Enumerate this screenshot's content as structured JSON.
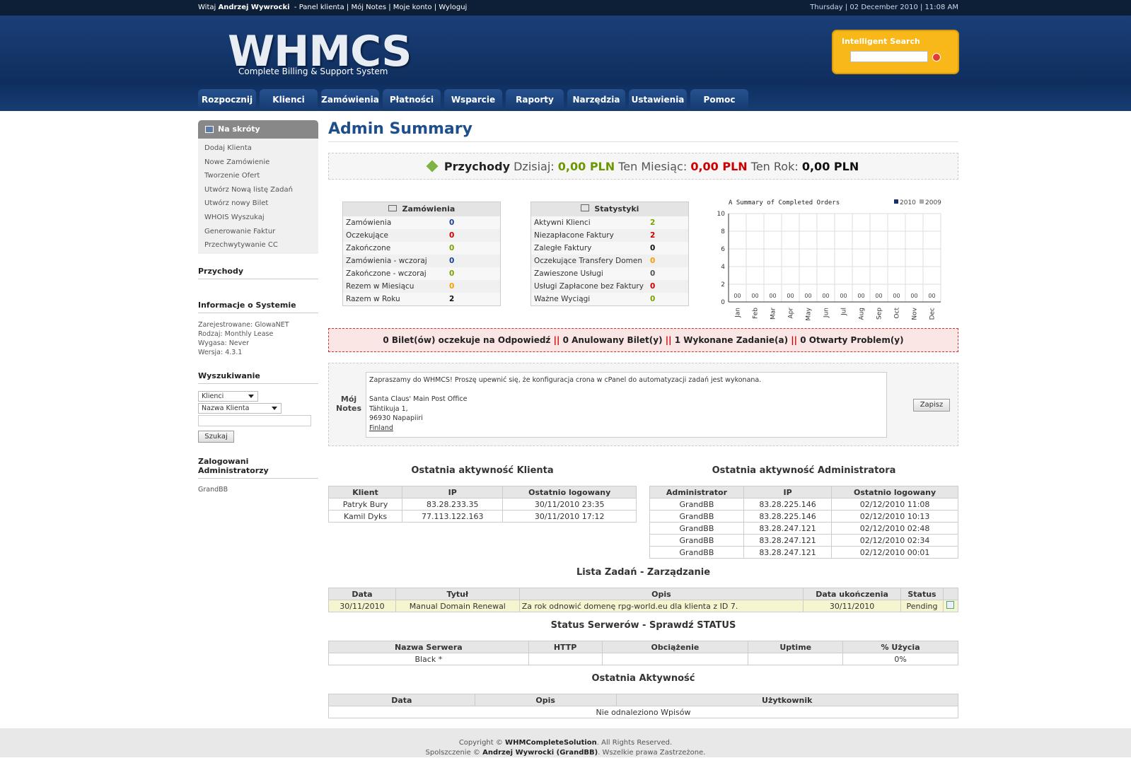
{
  "topbar": {
    "welcome": "Witaj",
    "user": "Andrzej Wywrocki",
    "links": [
      "Panel klienta",
      "Mój Notes",
      "Moje konto",
      "Wyloguj"
    ],
    "datetime": "Thursday | 02 December 2010 | 11:08 AM"
  },
  "header": {
    "logo": "WHMCS",
    "tagline": "Complete Billing & Support System",
    "search_title": "Intelligent Search"
  },
  "nav": [
    "Rozpocznij",
    "Klienci",
    "Zamówienia",
    "Płatności",
    "Wsparcie",
    "Raporty",
    "Narzędzia",
    "Ustawienia",
    "Pomoc"
  ],
  "sidebar": {
    "shortcuts_title": "Na skróty",
    "shortcuts": [
      "Dodaj Klienta",
      "Nowe Zamówienie",
      "Tworzenie Ofert",
      "Utwórz Nową listę Zadań",
      "Utwórz nowy Bilet",
      "WHOIS Wyszukaj",
      "Generowanie Faktur",
      "Przechwytywanie CC"
    ],
    "income_title": "Przychody",
    "sysinfo_title": "Informacje o Systemie",
    "sysinfo": [
      "Zarejestrowane: GlowaNET",
      "Rodzaj: Monthly Lease",
      "Wygasa: Never",
      "Wersja: 4.3.1"
    ],
    "search_title": "Wyszukiwanie",
    "search_select1": "Klienci",
    "search_select2": "Nazwa Klienta",
    "search_button": "Szukaj",
    "admins_title": "Zalogowani Administratorzy",
    "admins": "GrandBB"
  },
  "main": {
    "title": "Admin Summary",
    "income": {
      "label": "Przychody",
      "today_label": "Dzisiaj:",
      "today": "0,00 PLN",
      "month_label": "Ten Miesiąc:",
      "month": "0,00 PLN",
      "year_label": "Ten Rok:",
      "year": "0,00 PLN"
    },
    "orders": {
      "title": "Zamówienia",
      "rows": [
        {
          "label": "Zamówienia",
          "value": "0",
          "color": "#1a3f9a"
        },
        {
          "label": "Oczekujące",
          "value": "0",
          "color": "#cc0000"
        },
        {
          "label": "Zakończone",
          "value": "0",
          "color": "#77a300"
        },
        {
          "label": "Zamówienia - wczoraj",
          "value": "0",
          "color": "#1a3f9a"
        },
        {
          "label": "Zakończone - wczoraj",
          "value": "0",
          "color": "#77a300"
        },
        {
          "label": "Rezem w Miesiącu",
          "value": "0",
          "color": "#f2a000"
        },
        {
          "label": "Razem w Roku",
          "value": "2",
          "color": "#111111"
        }
      ]
    },
    "stats": {
      "title": "Statystyki",
      "rows": [
        {
          "label": "Aktywni Klienci",
          "value": "2",
          "color": "#77a300"
        },
        {
          "label": "Niezapłacone Faktury",
          "value": "2",
          "color": "#cc0000"
        },
        {
          "label": "Zaległe Faktury",
          "value": "0",
          "color": "#111111"
        },
        {
          "label": "Oczekujące Transfery Domen",
          "value": "0",
          "color": "#f2a000"
        },
        {
          "label": "Zawieszone Usługi",
          "value": "0",
          "color": "#555555"
        },
        {
          "label": "Usługi Zapłacone bez Faktury",
          "value": "0",
          "color": "#cc0000"
        },
        {
          "label": "Ważne Wyciągi",
          "value": "0",
          "color": "#77a300"
        }
      ]
    },
    "tickets": {
      "t1": "0 Bilet(ów) oczekuje na Odpowiedź",
      "t2": "0 Anulowany Bilet(y)",
      "t3": "1 Wykonane Zadanie(a)",
      "t4": "0 Otwarty Problem(y)",
      "sep": "||"
    },
    "notes": {
      "label1": "Mój",
      "label2": "Notes",
      "lines": [
        "Zapraszamy do WHMCS! Proszę upewnić się, że konfiguracja crona w cPanel do automatyzacji zadań jest wykonana.",
        "",
        "Santa Claus' Main Post Office",
        "Tähtikuja 1,",
        "96930 Napapiiri",
        "Finland"
      ],
      "save": "Zapisz"
    },
    "client_activity": {
      "title": "Ostatnia aktywność Klienta",
      "headers": [
        "Klient",
        "IP",
        "Ostatnio logowany"
      ],
      "rows": [
        [
          "Patryk Bury",
          "83.28.233.35",
          "30/11/2010 23:35"
        ],
        [
          "Kamil Dyks",
          "77.113.122.163",
          "30/11/2010 17:12"
        ]
      ]
    },
    "admin_activity": {
      "title": "Ostatnia aktywność Administratora",
      "headers": [
        "Administrator",
        "IP",
        "Ostatnio logowany"
      ],
      "rows": [
        [
          "GrandBB",
          "83.28.225.146",
          "02/12/2010 11:08"
        ],
        [
          "GrandBB",
          "83.28.225.146",
          "02/12/2010 10:13"
        ],
        [
          "GrandBB",
          "83.28.247.121",
          "02/12/2010 02:48"
        ],
        [
          "GrandBB",
          "83.28.247.121",
          "02/12/2010 02:34"
        ],
        [
          "GrandBB",
          "83.28.247.121",
          "02/12/2010 00:01"
        ]
      ]
    },
    "todo": {
      "title": "Lista Zadań - ",
      "title_link": "Zarządzanie",
      "headers": [
        "Data",
        "Tytuł",
        "Opis",
        "Data ukończenia",
        "Status"
      ],
      "rows": [
        [
          "30/11/2010",
          "Manual Domain Renewal",
          "Za rok odnowić domenę rpg-world.eu dla klienta z ID 7.",
          "30/11/2010",
          "Pending"
        ]
      ]
    },
    "servers": {
      "title": "Status Serwerów - ",
      "title_link": "Sprawdź STATUS",
      "headers": [
        "Nazwa Serwera",
        "HTTP",
        "Obciążenie",
        "Uptime",
        "% Użycia"
      ],
      "rows": [
        [
          "Black *",
          "",
          "",
          "",
          "0%"
        ]
      ]
    },
    "activity": {
      "title": "Ostatnia Aktywność",
      "headers": [
        "Data",
        "Opis",
        "Użytkownik"
      ],
      "empty": "Nie odnaleziono Wpisów"
    }
  },
  "chart_data": {
    "type": "bar",
    "title": "A Summary of Completed Orders",
    "categories": [
      "Jan",
      "Feb",
      "Mar",
      "Apr",
      "May",
      "Jun",
      "Jul",
      "Aug",
      "Sep",
      "Oct",
      "Nov",
      "Dec"
    ],
    "series": [
      {
        "name": "2010",
        "values": [
          0,
          0,
          0,
          0,
          0,
          0,
          0,
          0,
          0,
          0,
          0,
          0
        ],
        "color": "#1a2f6a"
      },
      {
        "name": "2009",
        "values": [
          0,
          0,
          0,
          0,
          0,
          0,
          0,
          0,
          0,
          0,
          0,
          0
        ],
        "color": "#aaaaaa"
      }
    ],
    "data_labels": [
      "00",
      "00",
      "00",
      "00",
      "00",
      "00",
      "00",
      "00",
      "00",
      "00",
      "00",
      "00"
    ],
    "ylim": [
      0,
      10
    ],
    "yticks": [
      "0",
      "2",
      "4",
      "6",
      "8",
      "10"
    ],
    "legend": "top-right",
    "grid": true
  },
  "footer": {
    "line1_a": "Copyright ©",
    "line1_b": "WHMCompleteSolution",
    "line1_c": ". All Rights Reserved.",
    "line2_a": "Spolszczenie ©",
    "line2_b": "Andrzej Wywrocki (GrandBB)",
    "line2_c": ". Wszelkie prawa Zastrzeżone."
  }
}
